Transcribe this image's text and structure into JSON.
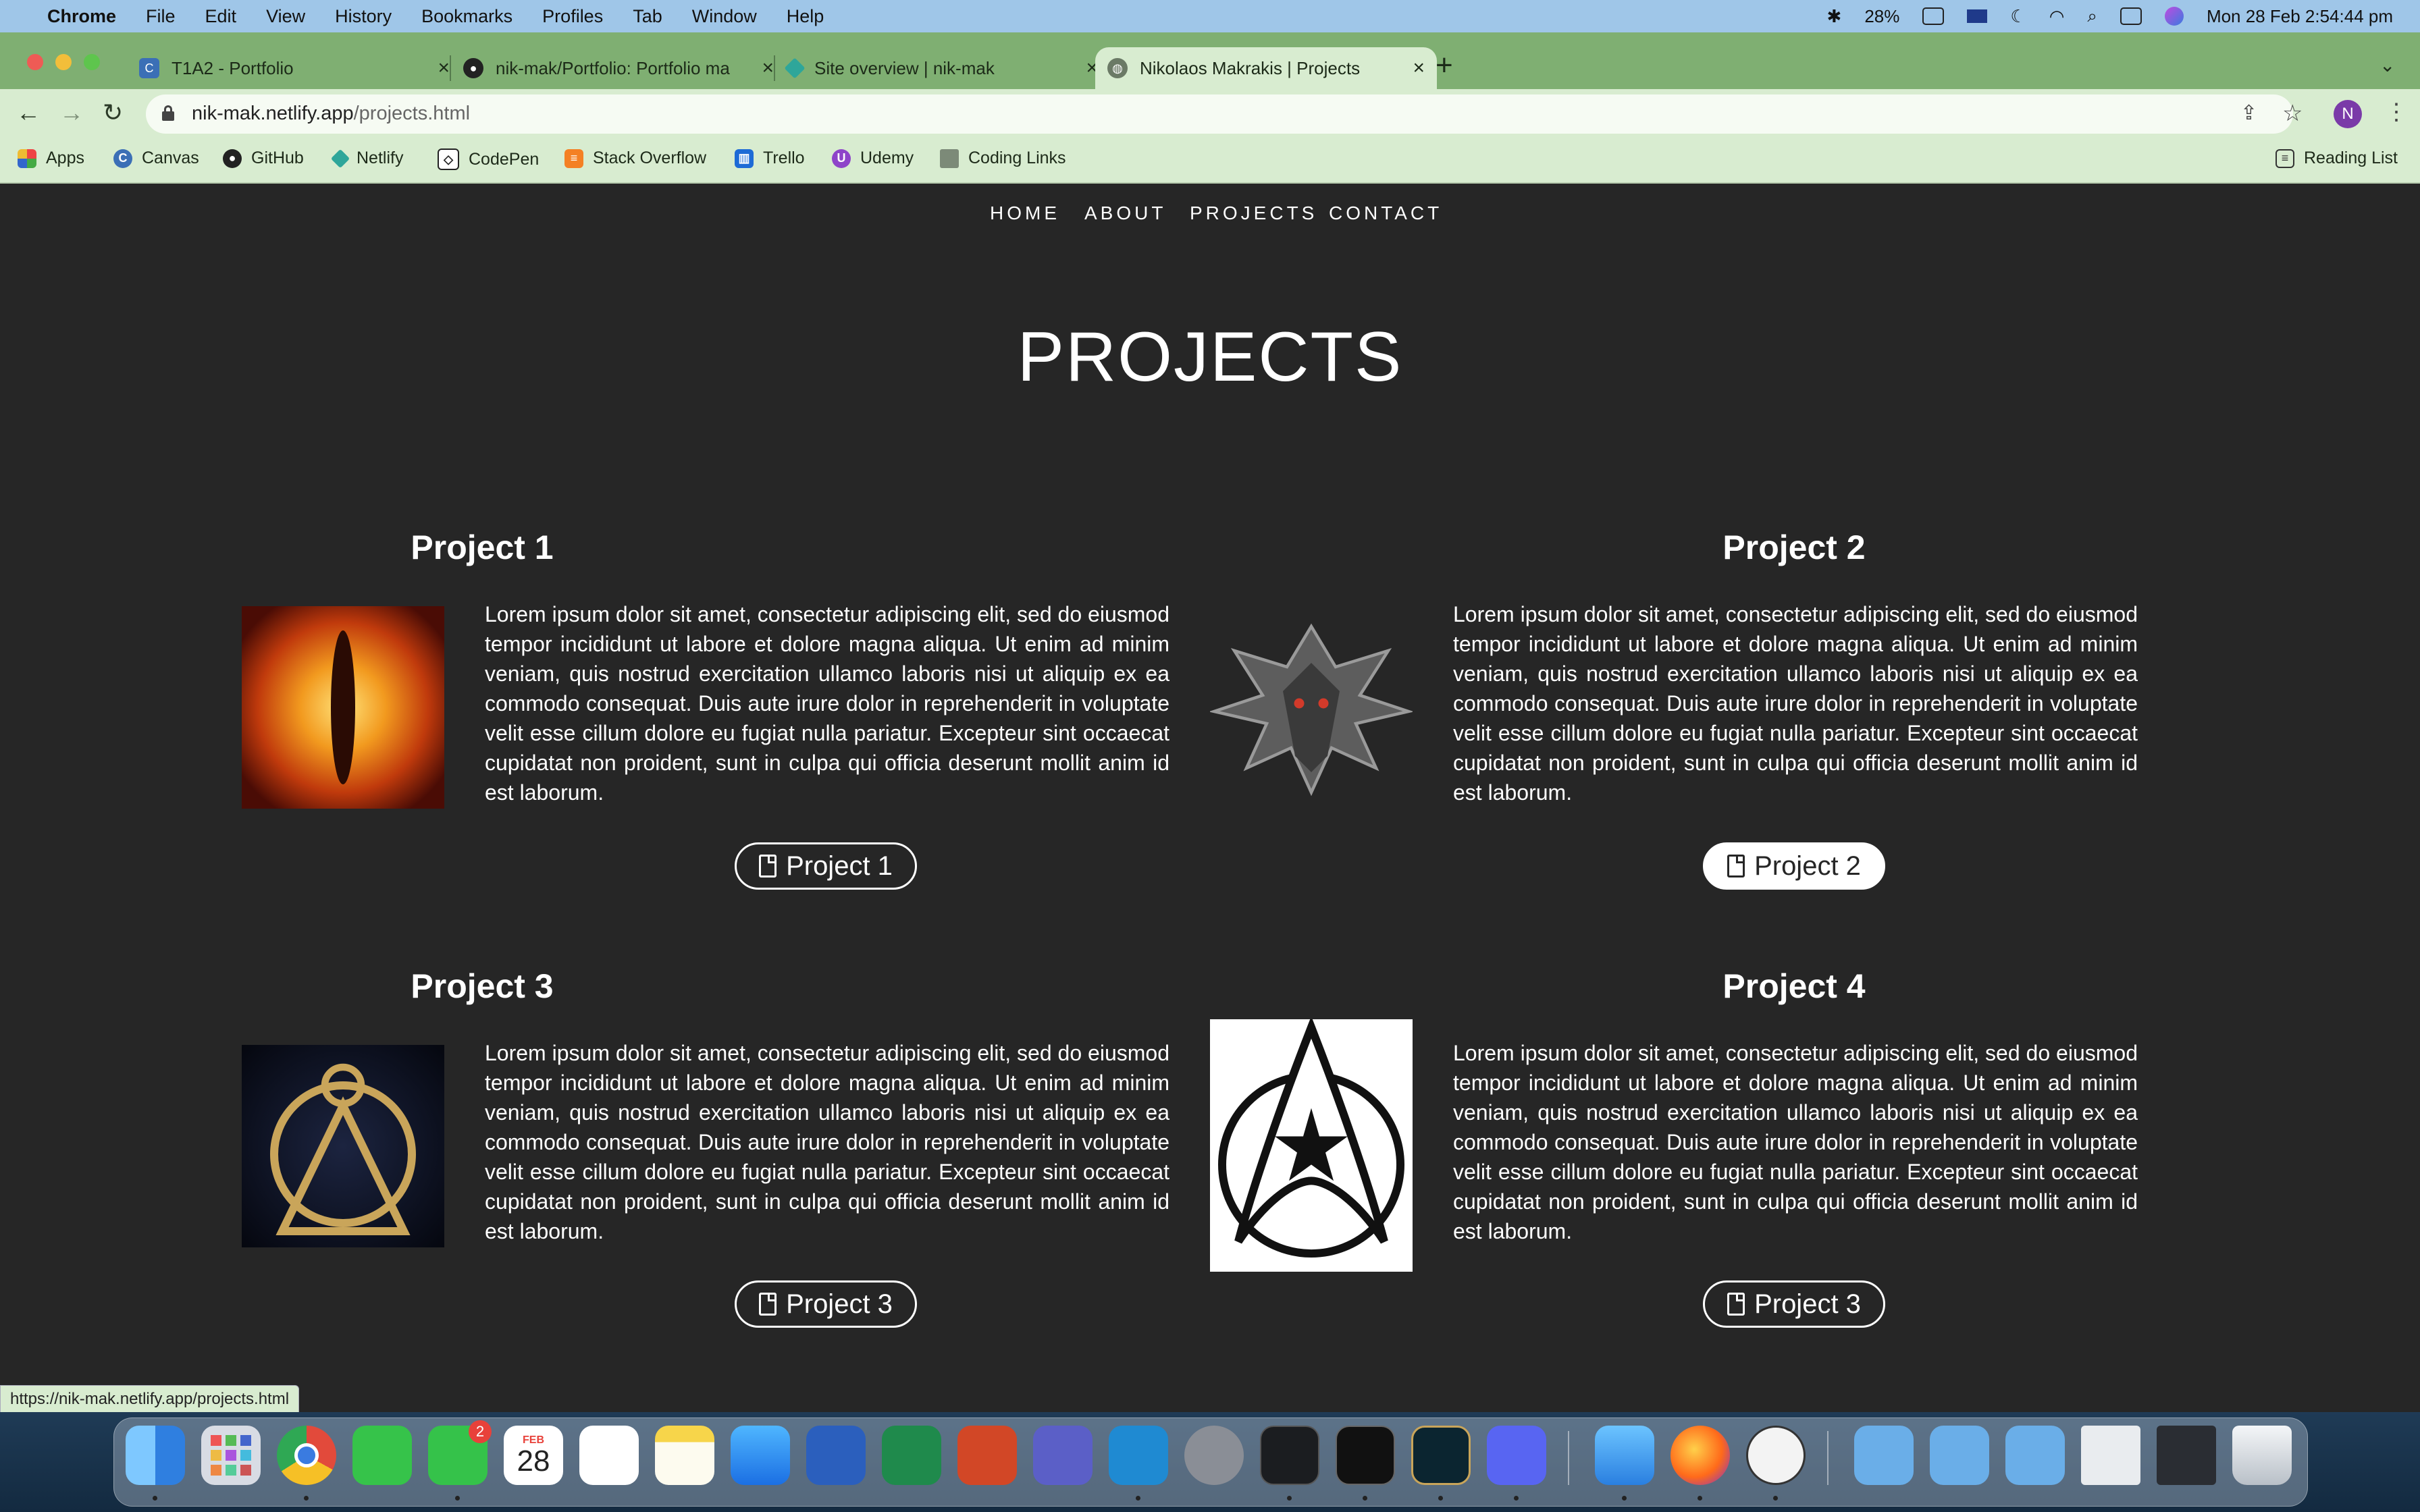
{
  "menubar": {
    "app": "Chrome",
    "items": [
      "File",
      "Edit",
      "View",
      "History",
      "Bookmarks",
      "Profiles",
      "Tab",
      "Window",
      "Help"
    ],
    "battery": "28%",
    "datetime": "Mon 28 Feb  2:54:44 pm"
  },
  "tabs": [
    {
      "title": "T1A2 - Portfolio",
      "icon": "canvas-icon"
    },
    {
      "title": "nik-mak/Portfolio: Portfolio ma",
      "icon": "github-icon"
    },
    {
      "title": "Site overview | nik-mak",
      "icon": "netlify-icon"
    },
    {
      "title": "Nikolaos Makrakis | Projects",
      "icon": "globe-icon",
      "active": true
    }
  ],
  "address": {
    "host": "nik-mak.netlify.app",
    "path": "/projects.html"
  },
  "profile_initial": "N",
  "bookmarks": [
    "Apps",
    "Canvas",
    "GitHub",
    "Netlify",
    "CodePen",
    "Stack Overflow",
    "Trello",
    "Udemy",
    "Coding Links"
  ],
  "reading_list": "Reading List",
  "site": {
    "nav": [
      "HOME",
      "ABOUT",
      "PROJECTS",
      "CONTACT"
    ],
    "title": "PROJECTS",
    "projects": [
      {
        "heading": "Project 1",
        "button": "Project 1",
        "image": "eye-of-sauron-image",
        "text": "Lorem ipsum dolor sit amet, consectetur adipiscing elit, sed do eiusmod tempor incididunt ut labore et dolore magna aliqua. Ut enim ad minim veniam, quis nostrud exercitation ullamco laboris nisi ut aliquip ex ea commodo consequat. Duis aute irure dolor in reprehenderit in voluptate velit esse cillum dolore eu fugiat nulla pariatur. Excepteur sint occaecat cupidatat non proident, sunt in culpa qui officia deserunt mollit anim id est laborum."
      },
      {
        "heading": "Project 2",
        "button": "Project 2",
        "image": "witcher-wolf-medallion-image",
        "text": "Lorem ipsum dolor sit amet, consectetur adipiscing elit, sed do eiusmod tempor incididunt ut labore et dolore magna aliqua. Ut enim ad minim veniam, quis nostrud exercitation ullamco laboris nisi ut aliquip ex ea commodo consequat. Duis aute irure dolor in reprehenderit in voluptate velit esse cillum dolore eu fugiat nulla pariatur. Excepteur sint occaecat cupidatat non proident, sunt in culpa qui officia deserunt mollit anim id est laborum."
      },
      {
        "heading": "Project 3",
        "button": "Project 3",
        "image": "stargate-logo-image",
        "text": "Lorem ipsum dolor sit amet, consectetur adipiscing elit, sed do eiusmod tempor incididunt ut labore et dolore magna aliqua. Ut enim ad minim veniam, quis nostrud exercitation ullamco laboris nisi ut aliquip ex ea commodo consequat. Duis aute irure dolor in reprehenderit in voluptate velit esse cillum dolore eu fugiat nulla pariatur. Excepteur sint occaecat cupidatat non proident, sunt in culpa qui officia deserunt mollit anim id est laborum."
      },
      {
        "heading": "Project 4",
        "button": "Project 3",
        "image": "starfleet-insignia-image",
        "text": "Lorem ipsum dolor sit amet, consectetur adipiscing elit, sed do eiusmod tempor incididunt ut labore et dolore magna aliqua. Ut enim ad minim veniam, quis nostrud exercitation ullamco laboris nisi ut aliquip ex ea commodo consequat. Duis aute irure dolor in reprehenderit in voluptate velit esse cillum dolore eu fugiat nulla pariatur. Excepteur sint occaecat cupidatat non proident, sunt in culpa qui officia deserunt mollit anim id est laborum."
      }
    ]
  },
  "status_url": "https://nik-mak.netlify.app/projects.html",
  "dock": {
    "apps": [
      "finder-icon",
      "launchpad-icon",
      "chrome-icon",
      "facetime-icon",
      "messages-icon",
      "calendar-icon",
      "reminders-icon",
      "notes-icon",
      "app-store-icon",
      "word-icon",
      "excel-icon",
      "powerpoint-icon",
      "teams-icon",
      "vscode-icon",
      "system-preferences-icon",
      "activity-monitor-icon",
      "terminal-icon",
      "league-of-legends-icon",
      "discord-icon",
      "mail-icon",
      "firefox-icon",
      "memoji-icon",
      "documents-folder-icon",
      "applications-folder-icon",
      "downloads-folder-icon",
      "recent-window-icon",
      "recent-window-2-icon",
      "trash-icon"
    ],
    "messages_badge": "2",
    "calendar_month": "FEB",
    "calendar_day": "28"
  },
  "colors": {
    "page_bg": "#262626",
    "tab_strip": "#7faf72",
    "toolbar": "#d8ecd0",
    "menubar": "#9fc6e8"
  }
}
